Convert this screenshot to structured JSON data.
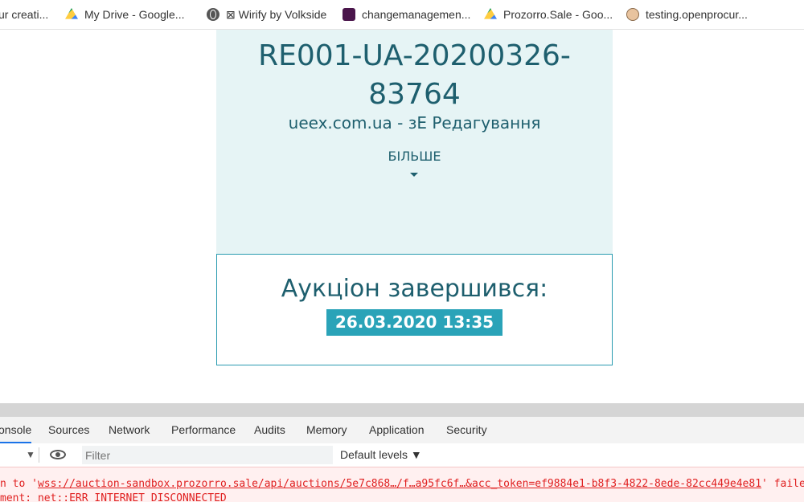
{
  "bookmarks": [
    {
      "label": "ur creati...",
      "icon": "bookmark-icon"
    },
    {
      "label": "My Drive - Google...",
      "icon": "google-drive-icon"
    },
    {
      "label": "⊠ Wirify by Volkside",
      "icon": "globe-icon"
    },
    {
      "label": "changemanagemen...",
      "icon": "slack-icon"
    },
    {
      "label": "Prozorro.Sale - Goo...",
      "icon": "google-drive-icon"
    },
    {
      "label": "testing.openprocur...",
      "icon": "avatar-icon"
    }
  ],
  "auction": {
    "code_line1": "RE001-UA-20200326-",
    "code_line2": "83764",
    "subtitle": "ueex.com.ua - зЕ Редагування",
    "more_label": "БІЛЬШЕ",
    "ended_label": "Аукціон завершився:",
    "ended_date": "26.03.2020 13:35"
  },
  "devtools": {
    "tabs": [
      "onsole",
      "Sources",
      "Network",
      "Performance",
      "Audits",
      "Memory",
      "Application",
      "Security"
    ],
    "active_tab": "onsole",
    "filter_placeholder": "Filter",
    "levels_label": "Default levels ▼",
    "console_lines": [
      {
        "prefix": "n to '",
        "link": "wss://auction-sandbox.prozorro.sale/api/auctions/5e7c868…/f…a95fc6f…&acc_token=ef9884e1-b8f3-4822-8ede-82cc449e4e81",
        "suffix": "' failed: Err"
      },
      {
        "prefix": "ment: net::ERR_INTERNET_DISCONNECTED",
        "link": "",
        "suffix": ""
      }
    ]
  }
}
